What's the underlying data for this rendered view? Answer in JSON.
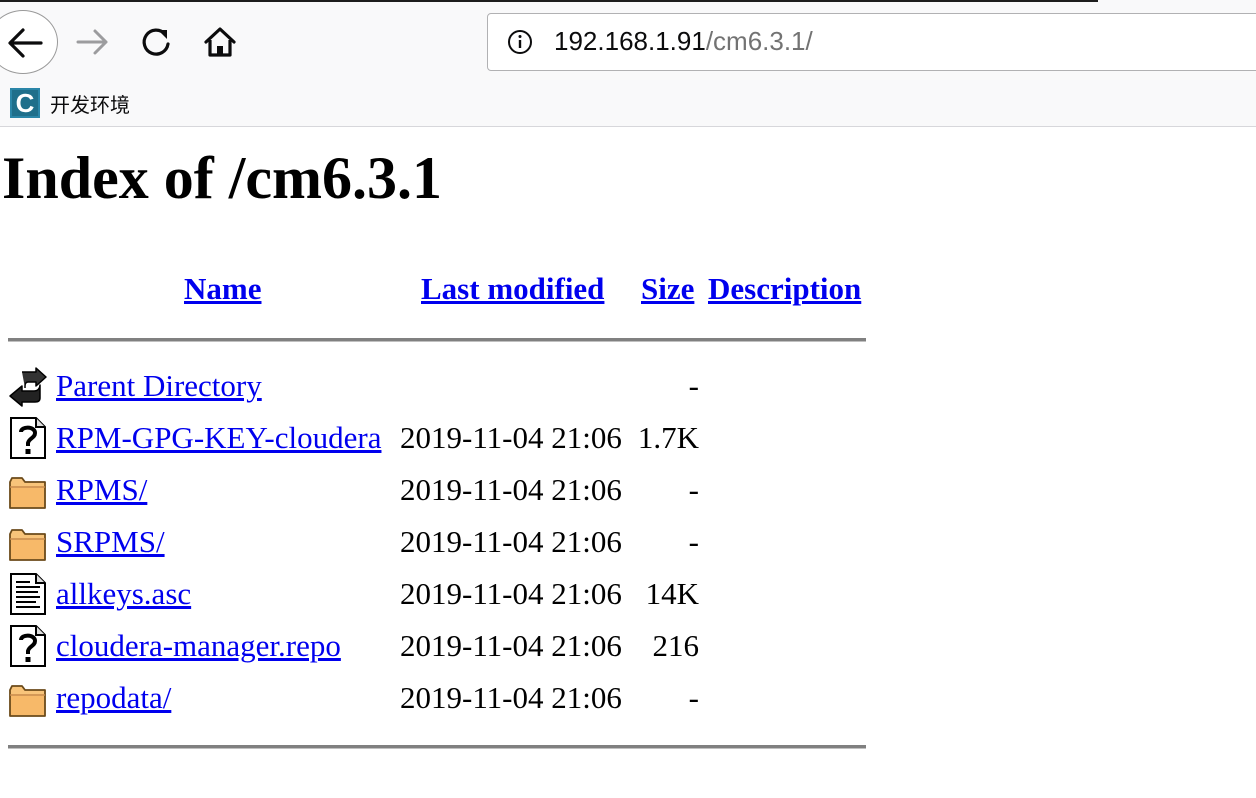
{
  "browser": {
    "url_host": "192.168.1.91",
    "url_path": "/cm6.3.1/",
    "bookmarks": [
      {
        "label": "开发环境",
        "favicon_letter": "C"
      }
    ]
  },
  "page": {
    "title": "Index of /cm6.3.1",
    "columns": {
      "name": "Name",
      "last_modified": "Last modified",
      "size": "Size",
      "description": "Description"
    },
    "rows": [
      {
        "name": "Parent Directory",
        "date": "",
        "size": "-",
        "icon": "back-arrow-icon"
      },
      {
        "name": "RPM-GPG-KEY-cloudera",
        "date": "2019-11-04 21:06",
        "size": "1.7K",
        "icon": "unknown-file-icon"
      },
      {
        "name": "RPMS/",
        "date": "2019-11-04 21:06",
        "size": "-",
        "icon": "folder-icon"
      },
      {
        "name": "SRPMS/",
        "date": "2019-11-04 21:06",
        "size": "-",
        "icon": "folder-icon"
      },
      {
        "name": "allkeys.asc",
        "date": "2019-11-04 21:06",
        "size": "14K",
        "icon": "text-file-icon"
      },
      {
        "name": "cloudera-manager.repo",
        "date": "2019-11-04 21:06",
        "size": "216",
        "icon": "unknown-file-icon"
      },
      {
        "name": "repodata/",
        "date": "2019-11-04 21:06",
        "size": "-",
        "icon": "folder-icon"
      }
    ]
  },
  "colors": {
    "link": "#0000ee",
    "chrome_bg": "#f9f9fa",
    "rule": "#808080"
  }
}
